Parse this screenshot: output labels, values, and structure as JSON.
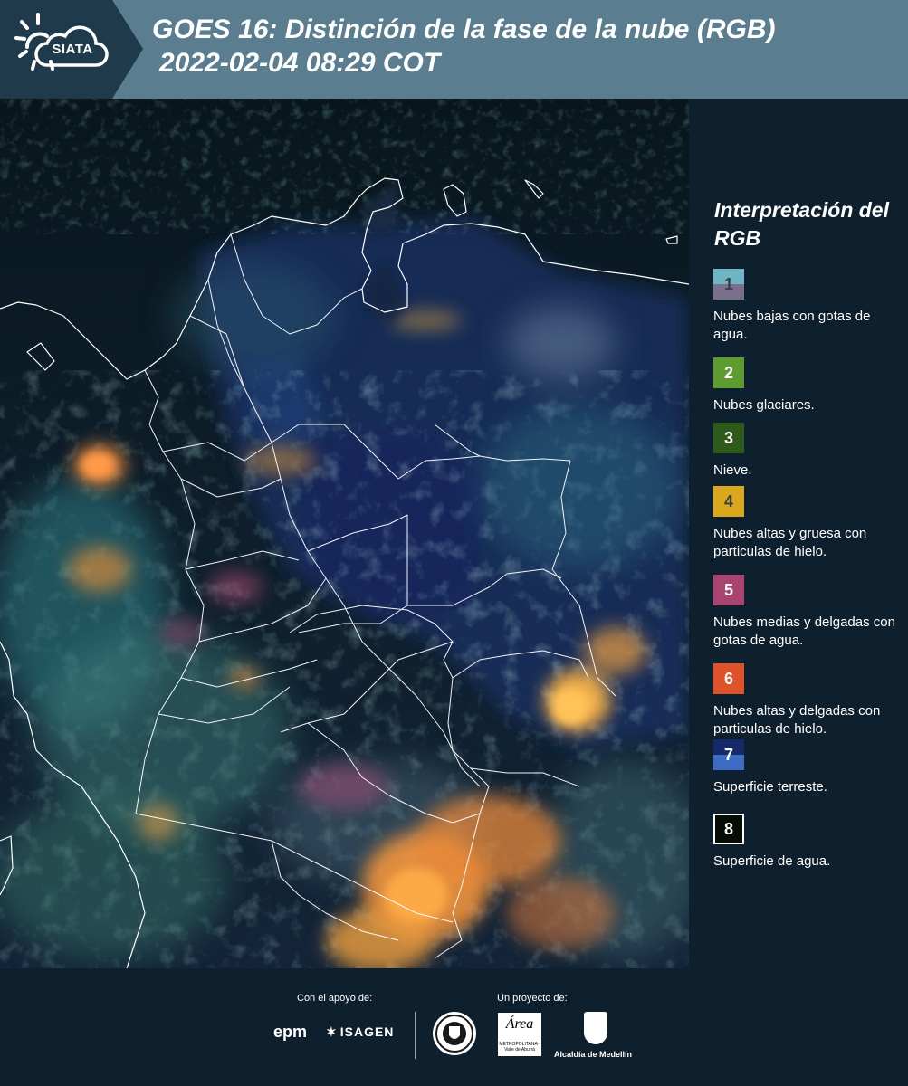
{
  "header": {
    "logo_text": "SIATA",
    "title_line1": "GOES 16: Distinción de la fase de la nube (RGB)",
    "title_line2": "2022-02-04 08:29 COT"
  },
  "legend": {
    "title": "Interpretación del RGB",
    "items": [
      {
        "number": "1",
        "label": "Nubes bajas con gotas de agua.",
        "color": "#6fb5c4",
        "color_secondary": "#7b6f8e",
        "text_color": "#3d3d4a"
      },
      {
        "number": "2",
        "label": "Nubes glaciares.",
        "color": "#5f9c2f",
        "text_color": "#ffffff"
      },
      {
        "number": "3",
        "label": "Nieve.",
        "color": "#2e5a1c",
        "text_color": "#ffffff"
      },
      {
        "number": "4",
        "label": "Nubes altas y gruesa con particulas de hielo.",
        "color": "#d9a81d",
        "text_color": "#3d3d3d"
      },
      {
        "number": "5",
        "label": "Nubes medias y delgadas con gotas de agua.",
        "color": "#a8446f",
        "text_color": "#ffffff"
      },
      {
        "number": "6",
        "label": "Nubes altas y delgadas con particulas de hielo.",
        "color": "#e0522a",
        "text_color": "#ffffff"
      },
      {
        "number": "7",
        "label": "Superficie terreste.",
        "color": "#152a6b",
        "color_secondary": "#3d6bc4",
        "text_color": "#ffffff"
      },
      {
        "number": "8",
        "label": "Superficie de agua.",
        "color": "#050c06",
        "text_color": "#ffffff"
      }
    ]
  },
  "footer": {
    "support_label": "Con el apoyo de:",
    "project_label": "Un proyecto de:",
    "epm": "epm",
    "isagen": "ISAGEN",
    "area_logo": "Área",
    "area_sub": "METROPOLITANA · Valle de Aburrá",
    "alcaldia": "Alcaldía de Medellín"
  }
}
